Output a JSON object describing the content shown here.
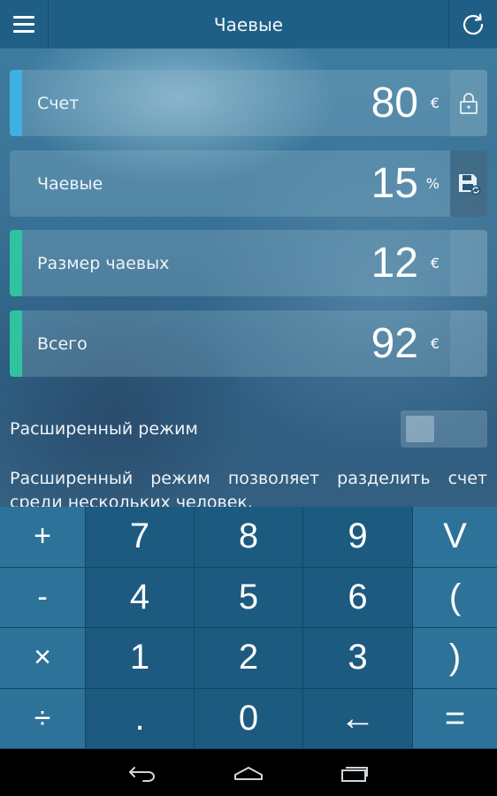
{
  "header": {
    "title": "Чаевые"
  },
  "fields": [
    {
      "label": "Счет",
      "value": "80",
      "unit": "€",
      "stripe_color": "#3fb0e4",
      "side_icon": "lock-icon"
    },
    {
      "label": "Чаевые",
      "value": "15",
      "unit": "%",
      "stripe_color": "",
      "side_icon": "save-icon"
    },
    {
      "label": "Размер чаевых",
      "value": "12",
      "unit": "€",
      "stripe_color": "#2fc3a0",
      "side_icon": ""
    },
    {
      "label": "Всего",
      "value": "92",
      "unit": "€",
      "stripe_color": "#2fc3a0",
      "side_icon": ""
    }
  ],
  "advanced": {
    "label": "Расширенный режим",
    "toggle_on": false,
    "description": "Расширенный режим позволяет разделить счет среди нескольких человек."
  },
  "keypad": {
    "rows": [
      [
        "+",
        "7",
        "8",
        "9",
        "V"
      ],
      [
        "-",
        "4",
        "5",
        "6",
        "("
      ],
      [
        "×",
        "1",
        "2",
        "3",
        ")"
      ],
      [
        "÷",
        ".",
        "0",
        "←",
        "="
      ]
    ]
  },
  "navbar": {
    "icons": [
      "back-icon",
      "home-icon",
      "recent-apps-icon"
    ]
  },
  "colors": {
    "topbar": "#1f5f86",
    "keypad_operator": "#2d7299",
    "keypad_number": "#1d5a7f",
    "accent_blue": "#3fb0e4",
    "accent_green": "#2fc3a0"
  }
}
